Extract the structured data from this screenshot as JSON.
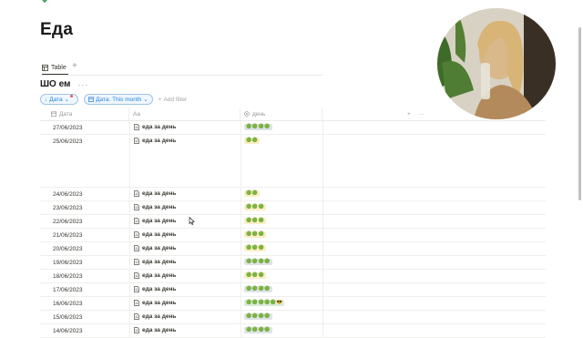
{
  "page": {
    "title": "Еда"
  },
  "view_tabs": {
    "table_label": "Table",
    "add": "+"
  },
  "database": {
    "title": "ШО ем",
    "more": "···"
  },
  "filters": {
    "sort_label": "Дата",
    "filter_label": "Дата: This month",
    "add_filter": "Add filter"
  },
  "table": {
    "headers": {
      "date": "Дата",
      "name": "Aa",
      "day": "день",
      "add": "+",
      "more": "···"
    },
    "rows": [
      {
        "date": "27/06/2023",
        "name": "еда за день",
        "day_tag": "🟢🟢🟢🟢",
        "tag_color": "gray"
      },
      {
        "date": "25/06/2023",
        "name": "еда за день",
        "day_tag": "🟢🟢",
        "tag_color": "yellow"
      },
      {
        "date": "24/06/2023",
        "name": "еда за день",
        "day_tag": "🟢🟢",
        "tag_color": "yellow"
      },
      {
        "date": "23/06/2023",
        "name": "еда за день",
        "day_tag": "🟢🟢🟢",
        "tag_color": "yellow"
      },
      {
        "date": "22/06/2023",
        "name": "еда за день",
        "day_tag": "🟢🟢🟢",
        "tag_color": "yellow"
      },
      {
        "date": "21/06/2023",
        "name": "еда за день",
        "day_tag": "🟢🟢🟢",
        "tag_color": "yellow"
      },
      {
        "date": "20/06/2023",
        "name": "еда за день",
        "day_tag": "🟢🟢🟢",
        "tag_color": "yellow"
      },
      {
        "date": "19/06/2023",
        "name": "еда за день",
        "day_tag": "🟢🟢🟢🟢",
        "tag_color": "gray"
      },
      {
        "date": "18/06/2023",
        "name": "еда за день",
        "day_tag": "🟢🟢🟢",
        "tag_color": "yellow"
      },
      {
        "date": "17/06/2023",
        "name": "еда за день",
        "day_tag": "🟢🟢🟢🟢",
        "tag_color": "gray"
      },
      {
        "date": "16/06/2023",
        "name": "еда за день",
        "day_tag": "🟢🟢🟢🟢🟢😎",
        "tag_color": "green"
      },
      {
        "date": "15/06/2023",
        "name": "еда за день",
        "day_tag": "🟢🟢🟢🟢",
        "tag_color": "gray"
      },
      {
        "date": "14/06/2023",
        "name": "еда за день",
        "day_tag": "🟢🟢🟢🟢",
        "tag_color": "gray"
      }
    ]
  },
  "colors": {
    "accent": "#2383e2",
    "text": "#37352f",
    "muted": "#9b9a97"
  }
}
